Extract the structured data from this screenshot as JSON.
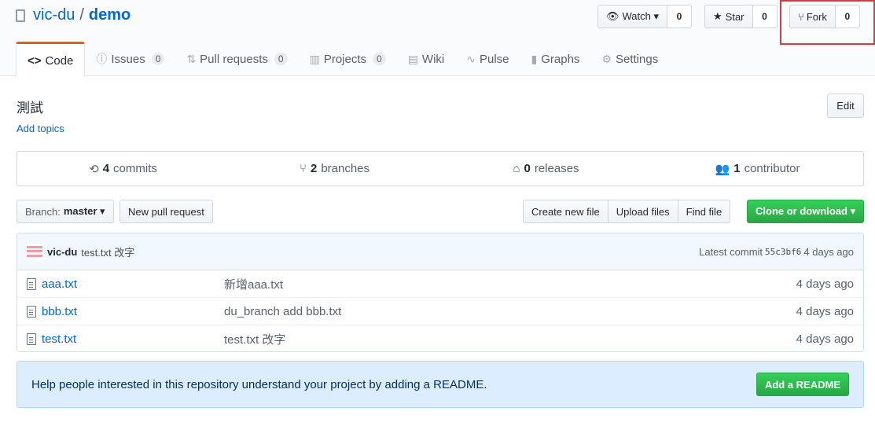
{
  "repo": {
    "owner": "vic-du",
    "separator": "/",
    "name": "demo"
  },
  "actions": {
    "watch": {
      "label": "Watch ▾",
      "count": "0"
    },
    "star": {
      "label": "Star",
      "count": "0"
    },
    "fork": {
      "label": "Fork",
      "count": "0"
    }
  },
  "tabs": [
    {
      "label": "Code",
      "icon": "code-icon"
    },
    {
      "label": "Issues",
      "badge": "0",
      "icon": "issue-icon"
    },
    {
      "label": "Pull requests",
      "badge": "0",
      "icon": "pull-request-icon"
    },
    {
      "label": "Projects",
      "badge": "0",
      "icon": "project-icon"
    },
    {
      "label": "Wiki",
      "icon": "book-icon"
    },
    {
      "label": "Pulse",
      "icon": "pulse-icon"
    },
    {
      "label": "Graphs",
      "icon": "graph-icon"
    },
    {
      "label": "Settings",
      "icon": "gear-icon"
    }
  ],
  "description": "測試",
  "add_topics": "Add topics",
  "edit_label": "Edit",
  "summary": {
    "commits": {
      "num": "4",
      "label": "commits"
    },
    "branches": {
      "num": "2",
      "label": "branches"
    },
    "releases": {
      "num": "0",
      "label": "releases"
    },
    "contributors": {
      "num": "1",
      "label": "contributor"
    }
  },
  "branch": {
    "prefix": "Branch:",
    "value": "master ▾"
  },
  "new_pr": "New pull request",
  "file_nav": {
    "create": "Create new file",
    "upload": "Upload files",
    "find": "Find file"
  },
  "clone": "Clone or download ▾",
  "latest_commit": {
    "author": "vic-du",
    "message": "test.txt 改字",
    "prefix": "Latest commit",
    "sha": "55c3bf6",
    "age": "4 days ago"
  },
  "files": [
    {
      "name": "aaa.txt",
      "message": "新增aaa.txt",
      "age": "4 days ago"
    },
    {
      "name": "bbb.txt",
      "message": "du_branch add bbb.txt",
      "age": "4 days ago"
    },
    {
      "name": "test.txt",
      "message": "test.txt 改字",
      "age": "4 days ago"
    }
  ],
  "readme": {
    "text": "Help people interested in this repository understand your project by adding a README.",
    "button": "Add a README"
  },
  "colors": {
    "accent": "#0366d6",
    "green": "#28a745",
    "tab_border": "#e36209",
    "highlight": "#d73a49"
  }
}
